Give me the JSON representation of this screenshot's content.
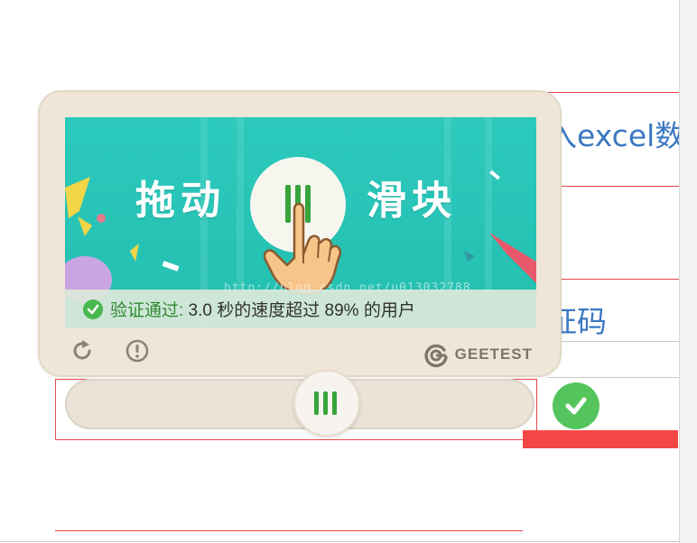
{
  "background": {
    "fragment_top": "入excel数",
    "fragment_mid": "证码"
  },
  "captcha": {
    "banner": {
      "title_left": "拖动",
      "title_right": "滑块",
      "watermark": "http://blog.csdn.net/u013032788"
    },
    "status": {
      "prefix": "验证通过:",
      "message": " 3.0 秒的速度超过 89% 的用户",
      "color": "#49b84f"
    },
    "footer": {
      "refresh_icon": "refresh-icon",
      "info_icon": "info-icon",
      "brand": "GEETEST"
    },
    "slider": {
      "handle_icon": "grip-bars-icon",
      "position": 0.54,
      "state": "success",
      "accent": "#38a43c"
    }
  },
  "colors": {
    "card_bg": "#efe6d8",
    "banner_bg": "#2cc9bd",
    "success": "#55c45d",
    "link_blue": "#3b78c2",
    "error_red": "#f54646"
  }
}
